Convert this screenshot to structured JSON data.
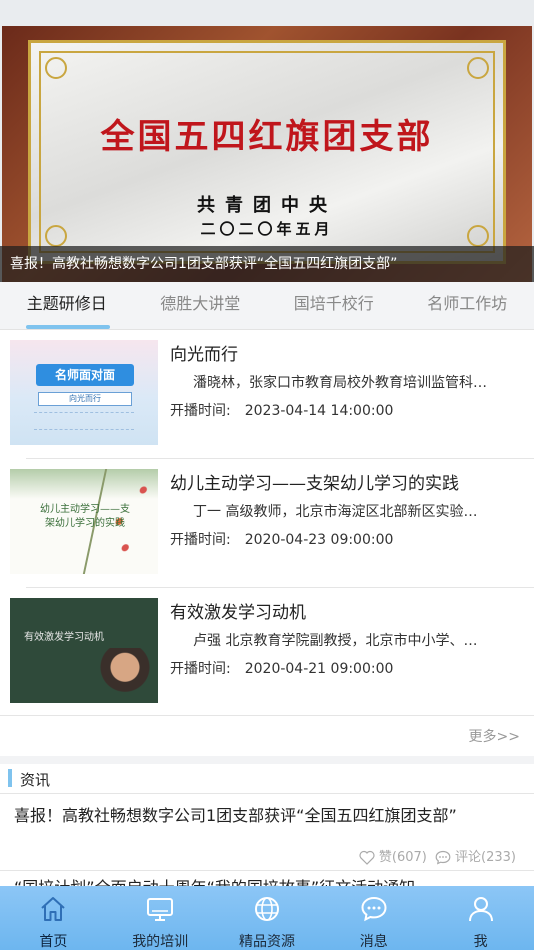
{
  "banner": {
    "plaque_title": "全国五四红旗团支部",
    "plaque_org": "共青团中央",
    "plaque_date": "二〇二〇年五月",
    "caption": "喜报！高教社畅想数字公司1团支部获评“全国五四红旗团支部”"
  },
  "tabs": [
    {
      "label": "主题研修日",
      "active": true
    },
    {
      "label": "德胜大讲堂",
      "active": false
    },
    {
      "label": "国培千校行",
      "active": false
    },
    {
      "label": "名师工作坊",
      "active": false
    }
  ],
  "courses": [
    {
      "title": "向光而行",
      "desc": "潘晓林，张家口市教育局校外教育培训监管科…",
      "time_label": "开播时间:",
      "time_value": "2023-04-14 14:00:00",
      "thumb_text": "名师面对面",
      "thumb_sub": "向光而行"
    },
    {
      "title": "幼儿主动学习——支架幼儿学习的实践",
      "desc": "丁一  高级教师，北京市海淀区北部新区实验…",
      "time_label": "开播时间:",
      "time_value": "2020-04-23 09:00:00",
      "thumb_text": "幼儿主动学习——支架幼儿学习的实践"
    },
    {
      "title": "有效激发学习动机",
      "desc": "卢强 北京教育学院副教授，北京市中小学、…",
      "time_label": "开播时间:",
      "time_value": "2020-04-21 09:00:00",
      "thumb_text": "有效激发学习动机"
    }
  ],
  "more_label": "更多>>",
  "news": {
    "section_label": "资讯",
    "item_title": "喜报！高教社畅想数字公司1团支部获评“全国五四红旗团支部”",
    "likes": "赞(607)",
    "comments": "评论(233)",
    "next_title": "“国培计划”全面启动十周年“我的国培故事”征文活动通知"
  },
  "bottom_nav": [
    {
      "label": "首页",
      "icon": "home-icon",
      "active": true
    },
    {
      "label": "我的培训",
      "icon": "monitor-icon",
      "active": false
    },
    {
      "label": "精品资源",
      "icon": "globe-icon",
      "active": false
    },
    {
      "label": "消息",
      "icon": "chat-icon",
      "active": false
    },
    {
      "label": "我",
      "icon": "user-icon",
      "active": false
    }
  ],
  "colors": {
    "accent": "#7fc3ee",
    "nav_bg": "#8cc6f6",
    "plaque_red": "#c0161c"
  }
}
